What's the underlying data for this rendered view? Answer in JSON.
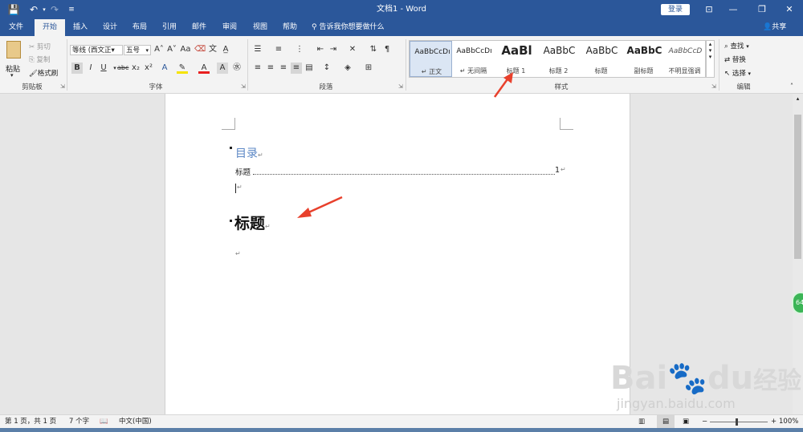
{
  "titlebar": {
    "title": "文档1 - Word",
    "login": "登录",
    "save_icon": "💾",
    "undo_icon": "↶",
    "redo_icon": "↷",
    "customize_icon": "≡",
    "restore_icon": "⊡",
    "minimize_icon": "—",
    "maximize_icon": "❐",
    "close_icon": "✕"
  },
  "tabs": [
    "文件",
    "开始",
    "插入",
    "设计",
    "布局",
    "引用",
    "邮件",
    "审阅",
    "视图",
    "帮助"
  ],
  "active_tab": "开始",
  "tell_me": "告诉我你想要做什么",
  "share": "共享",
  "clipboard": {
    "paste": "粘贴",
    "cut": "剪切",
    "copy": "复制",
    "format_painter": "格式刷",
    "label": "剪贴板"
  },
  "font": {
    "name": "等线 (西文正▾",
    "size": "五号",
    "bold": "B",
    "italic": "I",
    "underline": "U",
    "strike": "abc",
    "sub": "x₂",
    "sup": "x²",
    "grow": "A˄",
    "shrink": "A˅",
    "case": "Aa",
    "clear": "A",
    "phonetic": "wén",
    "label": "字体"
  },
  "paragraph": {
    "label": "段落"
  },
  "styles": {
    "label": "样式",
    "items": [
      {
        "preview": "AaBbCcDı",
        "name": "↵ 正文"
      },
      {
        "preview": "AaBbCcDı",
        "name": "↵ 无间隔"
      },
      {
        "preview": "AaBl",
        "name": "标题 1"
      },
      {
        "preview": "AaBbC",
        "name": "标题 2"
      },
      {
        "preview": "AaBbC",
        "name": "标题"
      },
      {
        "preview": "AaBbC",
        "name": "副标题"
      },
      {
        "preview": "AaBbCcD",
        "name": "不明显强调"
      }
    ]
  },
  "editing": {
    "find": "查找",
    "replace": "替换",
    "select": "选择",
    "label": "编辑"
  },
  "document": {
    "toc_title": "目录",
    "toc_entry": "标题",
    "toc_page": "1",
    "heading": "标题",
    "para_mark": "↵"
  },
  "status": {
    "page": "第 1 页，共 1 页",
    "words": "7 个字",
    "lang": "中文(中国)",
    "zoom": "100%"
  },
  "watermark": {
    "brand": "Bai",
    "brand2": "du",
    "cn": "经验",
    "url": "jingyan.baidu.com"
  },
  "colors": {
    "word_blue": "#2b579a",
    "ribbon_bg": "#f3f3f3",
    "arrow_red": "#e8402c"
  }
}
